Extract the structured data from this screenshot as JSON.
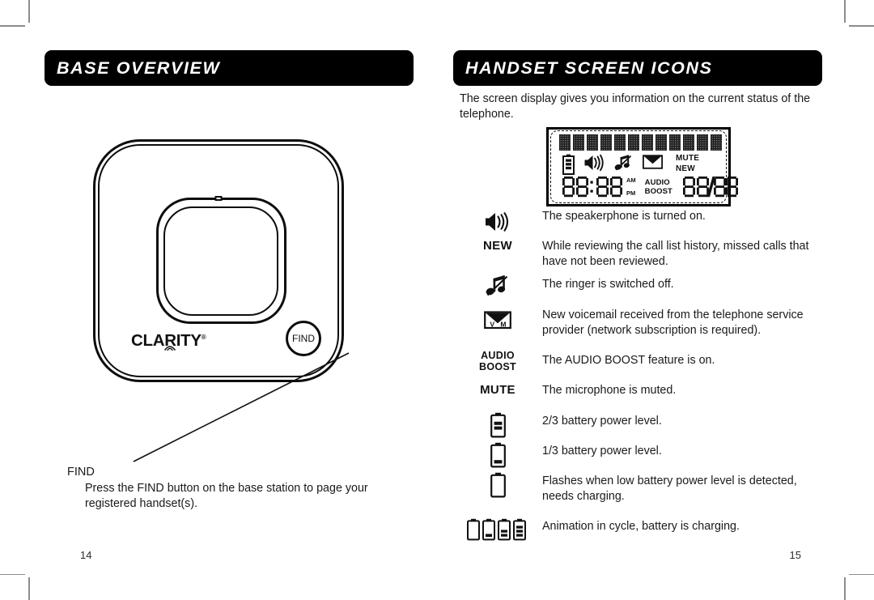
{
  "document": {
    "left_page_number": "14",
    "right_page_number": "15"
  },
  "left_page": {
    "header": "BASE OVERVIEW",
    "illustration": {
      "brand_logo": "CLARITY",
      "brand_registered_mark": "®",
      "find_button_label": "FIND"
    },
    "callout": {
      "title": "FIND",
      "description": "Press the FIND button on the base station to page your registered handset(s)."
    }
  },
  "right_page": {
    "header": "HANDSET SCREEN ICONS",
    "intro": "The screen display gives you information on the current status of the telephone.",
    "lcd": {
      "dot_matrix_cells": 12,
      "indicators": [
        "battery-icon",
        "speaker-icon",
        "ringer-off-icon",
        "voicemail-icon"
      ],
      "mute_label": "MUTE",
      "new_label": "NEW",
      "time_digits": "88:88",
      "am_label": "AM",
      "pm_label": "PM",
      "audio_label": "AUDIO",
      "boost_label": "BOOST",
      "date_digits": "88/88"
    },
    "legend": [
      {
        "icon": "speaker-icon",
        "icon_text": "",
        "description": "The speakerphone is turned on."
      },
      {
        "icon": "new-text-icon",
        "icon_text": "NEW",
        "description": "While reviewing the call list history, missed calls that have not been reviewed."
      },
      {
        "icon": "ringer-off-icon",
        "icon_text": "",
        "description": "The ringer is switched off."
      },
      {
        "icon": "voicemail-icon",
        "icon_text": "",
        "description": "New voicemail received from the telephone service provider (network subscription is required)."
      },
      {
        "icon": "audio-boost-text-icon",
        "icon_text": "AUDIO BOOST",
        "icon_line1": "AUDIO",
        "icon_line2": "BOOST",
        "description": "The AUDIO BOOST feature is on."
      },
      {
        "icon": "mute-text-icon",
        "icon_text": "MUTE",
        "description": "The microphone is muted."
      },
      {
        "icon": "battery-two-thirds-icon",
        "icon_text": "",
        "description": "2/3 battery power level."
      },
      {
        "icon": "battery-one-third-icon",
        "icon_text": "",
        "description": "1/3 battery power level."
      },
      {
        "icon": "battery-empty-icon",
        "icon_text": "",
        "description": "Flashes when low battery power level is detected, needs charging."
      },
      {
        "icon": "battery-charging-animation-icon",
        "icon_text": "",
        "description": "Animation in cycle, battery is charging."
      }
    ]
  },
  "colors": {
    "ink": "#111111",
    "header_bar": "#000000",
    "header_text": "#ffffff",
    "crop_mark": "#8c8c8c"
  }
}
